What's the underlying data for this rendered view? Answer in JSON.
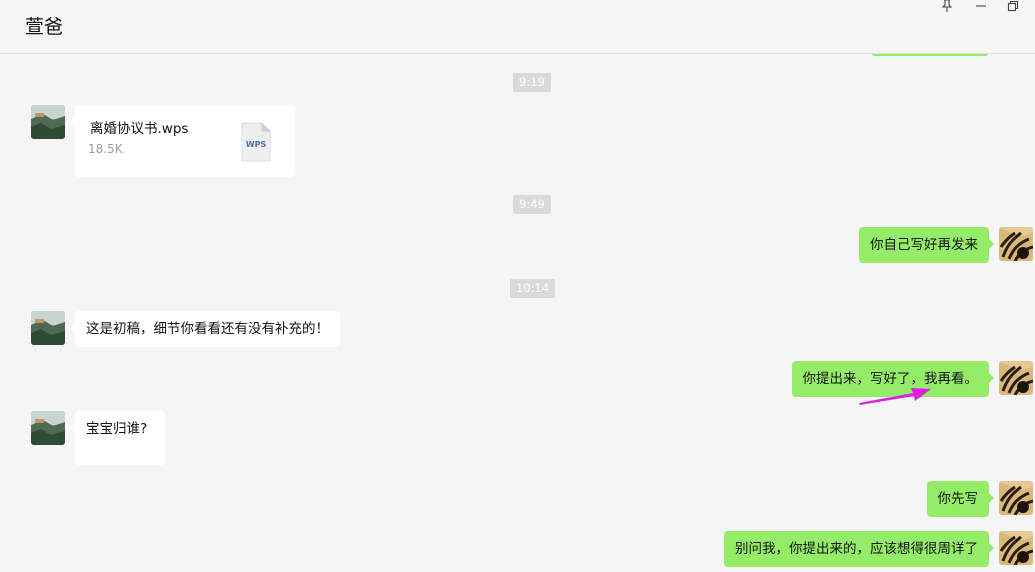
{
  "window": {
    "title": "萱爸",
    "controls": [
      "pin-icon",
      "minimize-icon",
      "restore-icon"
    ]
  },
  "colors": {
    "background": "#f5f5f5",
    "bubble_sent": "#95ec69",
    "bubble_received": "#ffffff",
    "timestamp_bg": "#dadada",
    "annotation_arrow": "#e020e0"
  },
  "timestamps": [
    "9:19",
    "9:49",
    "10:14"
  ],
  "messages": [
    {
      "side": "left",
      "type": "file",
      "file_name": "离婚协议书.wps",
      "file_size": "18.5K",
      "file_icon_label": "WPS"
    },
    {
      "side": "right",
      "type": "text",
      "text": "你自己写好再发来"
    },
    {
      "side": "left",
      "type": "text",
      "text": "这是初稿，细节你看看还有没有补充的！"
    },
    {
      "side": "right",
      "type": "text",
      "text": "你提出来，写好了，我再看。"
    },
    {
      "side": "left",
      "type": "text",
      "text": "宝宝归谁?"
    },
    {
      "side": "right",
      "type": "text",
      "text": "你先写"
    },
    {
      "side": "right",
      "type": "text",
      "text": "别问我，你提出来的，应该想得很周详了"
    }
  ]
}
